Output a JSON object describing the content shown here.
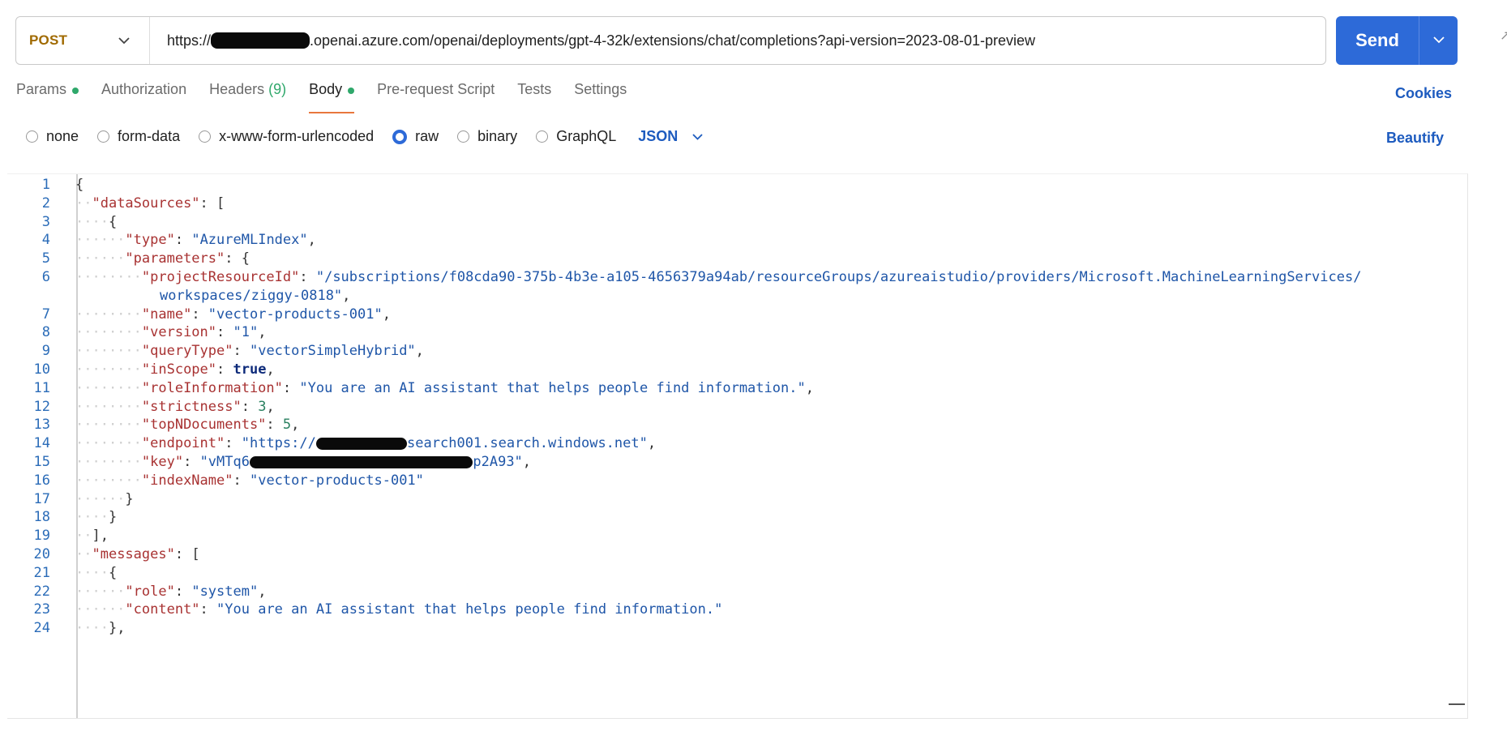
{
  "request": {
    "method": "POST",
    "url_prefix": "https://",
    "url_suffix": ".openai.azure.com/openai/deployments/gpt-4-32k/extensions/chat/completions?api-version=2023-08-01-preview",
    "send_label": "Send"
  },
  "tabs": [
    {
      "label": "Params",
      "dot": true
    },
    {
      "label": "Authorization"
    },
    {
      "label": "Headers",
      "count": "(9)"
    },
    {
      "label": "Body",
      "dot": true,
      "active": true
    },
    {
      "label": "Pre-request Script"
    },
    {
      "label": "Tests"
    },
    {
      "label": "Settings"
    }
  ],
  "cookies_label": "Cookies",
  "body_types": [
    {
      "label": "none",
      "selected": false
    },
    {
      "label": "form-data",
      "selected": false
    },
    {
      "label": "x-www-form-urlencoded",
      "selected": false
    },
    {
      "label": "raw",
      "selected": true
    },
    {
      "label": "binary",
      "selected": false
    },
    {
      "label": "GraphQL",
      "selected": false
    }
  ],
  "format_label": "JSON",
  "beautify_label": "Beautify",
  "colors": {
    "accent": "#2d6ad8",
    "method": "#a06a00",
    "active_tab_underline": "#e8773d",
    "status_dot": "#2fa86b"
  },
  "editor": {
    "lines": [
      {
        "n": "1",
        "indent": 0,
        "tokens": [
          [
            "p",
            "{"
          ]
        ]
      },
      {
        "n": "2",
        "indent": 1,
        "tokens": [
          [
            "k",
            "\"dataSources\""
          ],
          [
            "p",
            ": "
          ],
          [
            "p",
            "["
          ]
        ]
      },
      {
        "n": "3",
        "indent": 2,
        "tokens": [
          [
            "p",
            "{"
          ]
        ]
      },
      {
        "n": "4",
        "indent": 3,
        "tokens": [
          [
            "k",
            "\"type\""
          ],
          [
            "p",
            ": "
          ],
          [
            "s",
            "\"AzureMLIndex\""
          ],
          [
            "p",
            ","
          ]
        ]
      },
      {
        "n": "5",
        "indent": 3,
        "tokens": [
          [
            "k",
            "\"parameters\""
          ],
          [
            "p",
            ": "
          ],
          [
            "p",
            "{"
          ]
        ]
      },
      {
        "n": "6",
        "indent": 4,
        "tokens": [
          [
            "k",
            "\"projectResourceId\""
          ],
          [
            "p",
            ": "
          ],
          [
            "s",
            "\"/subscriptions/f08cda90-375b-4b3e-a105-4656379a94ab/resourceGroups/azureaistudio/providers/Microsoft.MachineLearningServices/"
          ]
        ]
      },
      {
        "n": "",
        "indent": 0,
        "wrap": true,
        "tokens": [
          [
            "s",
            "workspaces/ziggy-0818\""
          ],
          [
            "p",
            ","
          ]
        ]
      },
      {
        "n": "7",
        "indent": 4,
        "tokens": [
          [
            "k",
            "\"name\""
          ],
          [
            "p",
            ": "
          ],
          [
            "s",
            "\"vector-products-001\""
          ],
          [
            "p",
            ","
          ]
        ]
      },
      {
        "n": "8",
        "indent": 4,
        "tokens": [
          [
            "k",
            "\"version\""
          ],
          [
            "p",
            ": "
          ],
          [
            "s",
            "\"1\""
          ],
          [
            "p",
            ","
          ]
        ]
      },
      {
        "n": "9",
        "indent": 4,
        "tokens": [
          [
            "k",
            "\"queryType\""
          ],
          [
            "p",
            ": "
          ],
          [
            "s",
            "\"vectorSimpleHybrid\""
          ],
          [
            "p",
            ","
          ]
        ]
      },
      {
        "n": "10",
        "indent": 4,
        "tokens": [
          [
            "k",
            "\"inScope\""
          ],
          [
            "p",
            ": "
          ],
          [
            "b",
            "true"
          ],
          [
            "p",
            ","
          ]
        ]
      },
      {
        "n": "11",
        "indent": 4,
        "tokens": [
          [
            "k",
            "\"roleInformation\""
          ],
          [
            "p",
            ": "
          ],
          [
            "s",
            "\"You are an AI assistant that helps people find information.\""
          ],
          [
            "p",
            ","
          ]
        ]
      },
      {
        "n": "12",
        "indent": 4,
        "tokens": [
          [
            "k",
            "\"strictness\""
          ],
          [
            "p",
            ": "
          ],
          [
            "n",
            "3"
          ],
          [
            "p",
            ","
          ]
        ]
      },
      {
        "n": "13",
        "indent": 4,
        "tokens": [
          [
            "k",
            "\"topNDocuments\""
          ],
          [
            "p",
            ": "
          ],
          [
            "n",
            "5"
          ],
          [
            "p",
            ","
          ]
        ]
      },
      {
        "n": "14",
        "indent": 4,
        "tokens": [
          [
            "k",
            "\"endpoint\""
          ],
          [
            "p",
            ": "
          ],
          [
            "s",
            "\"https://"
          ],
          [
            "r",
            "           "
          ],
          [
            "s",
            "search001.search.windows.net\""
          ],
          [
            "p",
            ","
          ]
        ]
      },
      {
        "n": "15",
        "indent": 4,
        "tokens": [
          [
            "k",
            "\"key\""
          ],
          [
            "p",
            ": "
          ],
          [
            "s",
            "\"vMTq6"
          ],
          [
            "r",
            "                           "
          ],
          [
            "s",
            "p2A93\""
          ],
          [
            "p",
            ","
          ]
        ]
      },
      {
        "n": "16",
        "indent": 4,
        "tokens": [
          [
            "k",
            "\"indexName\""
          ],
          [
            "p",
            ": "
          ],
          [
            "s",
            "\"vector-products-001\""
          ]
        ]
      },
      {
        "n": "17",
        "indent": 3,
        "tokens": [
          [
            "p",
            "}"
          ]
        ]
      },
      {
        "n": "18",
        "indent": 2,
        "tokens": [
          [
            "p",
            "}"
          ]
        ]
      },
      {
        "n": "19",
        "indent": 1,
        "tokens": [
          [
            "p",
            "],"
          ]
        ]
      },
      {
        "n": "20",
        "indent": 1,
        "tokens": [
          [
            "k",
            "\"messages\""
          ],
          [
            "p",
            ": "
          ],
          [
            "p",
            "["
          ]
        ]
      },
      {
        "n": "21",
        "indent": 2,
        "tokens": [
          [
            "p",
            "{"
          ]
        ]
      },
      {
        "n": "22",
        "indent": 3,
        "tokens": [
          [
            "k",
            "\"role\""
          ],
          [
            "p",
            ": "
          ],
          [
            "s",
            "\"system\""
          ],
          [
            "p",
            ","
          ]
        ]
      },
      {
        "n": "23",
        "indent": 3,
        "tokens": [
          [
            "k",
            "\"content\""
          ],
          [
            "p",
            ": "
          ],
          [
            "s",
            "\"You are an AI assistant that helps people find information.\""
          ]
        ]
      },
      {
        "n": "24",
        "indent": 2,
        "tokens": [
          [
            "p",
            "},"
          ]
        ]
      }
    ]
  }
}
